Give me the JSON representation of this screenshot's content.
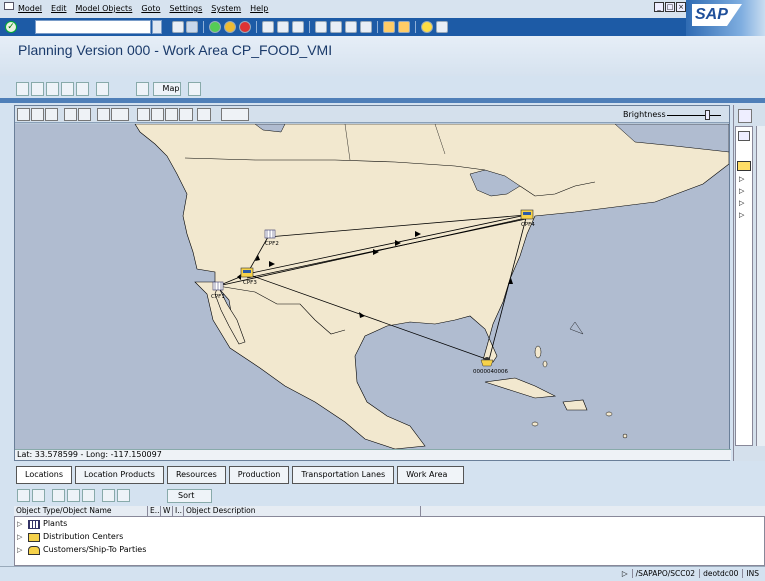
{
  "menu": {
    "items": [
      "Model",
      "Edit",
      "Model Objects",
      "Goto",
      "Settings",
      "System",
      "Help"
    ]
  },
  "brand": {
    "logo_text": "SAP"
  },
  "window_title": "Planning Version 000 - Work Area CP_FOOD_VMI",
  "app_toolbar": {
    "map_label": "Map"
  },
  "map": {
    "brightness_label": "Brightness",
    "brightness_level": 0.7,
    "coords": "Lat: 33.578599 - Long: -117.150097",
    "nodes": {
      "cpf1": "CPF1",
      "cpf2": "CPF2",
      "cpf3": "CPF3",
      "cpf4": "CPF4",
      "customer": "0000040006"
    },
    "colors": {
      "land": "#f2e8cf",
      "water": "#b0bcd0",
      "border": "#000000",
      "route": "#000000"
    }
  },
  "tabs": [
    "Locations",
    "Location Products",
    "Resources",
    "Production",
    "Transportation Lanes",
    "Work Area"
  ],
  "lower_toolbar": {
    "sort_label": "Sort"
  },
  "tree": {
    "headers": [
      "Object Type/Object Name",
      "E..",
      "W",
      "I..",
      "Object Description"
    ],
    "rows": [
      "Plants",
      "Distribution Centers",
      "Customers/Ship-To Parties"
    ]
  },
  "status": {
    "system": "/SAPAPO/SCC02",
    "server": "deotdc00",
    "mode": "INS"
  }
}
